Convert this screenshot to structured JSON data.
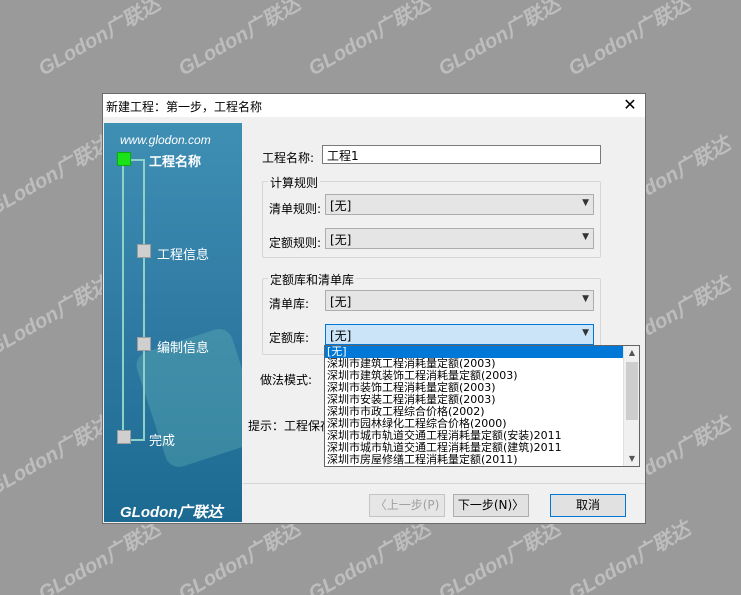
{
  "watermark": "GLodon广联达",
  "dialog": {
    "title": "新建工程：第一步，工程名称",
    "close": "✕"
  },
  "sidebar": {
    "url": "www.glodon.com",
    "logo": "GLodon广联达",
    "steps": [
      {
        "label": "工程名称",
        "active": true
      },
      {
        "label": "工程信息",
        "active": false
      },
      {
        "label": "编制信息",
        "active": false
      },
      {
        "label": "完成",
        "active": false
      }
    ]
  },
  "form": {
    "project_name_label": "工程名称:",
    "project_name_value": "工程1",
    "calc_rules": {
      "legend": "计算规则",
      "list_rule_label": "清单规则:",
      "list_rule_value": "[无]",
      "quota_rule_label": "定额规则:",
      "quota_rule_value": "[无]"
    },
    "libraries": {
      "legend": "定额库和清单库",
      "list_lib_label": "清单库:",
      "list_lib_value": "[无]",
      "quota_lib_label": "定额库:",
      "quota_lib_value": "[无]"
    },
    "method_label": "做法模式:",
    "hint_label": "提示：工程保存"
  },
  "quota_dropdown": {
    "options": [
      "[无]",
      "深圳市建筑工程消耗量定额(2003)",
      "深圳市建筑装饰工程消耗量定额(2003)",
      "深圳市装饰工程消耗量定额(2003)",
      "深圳市安装工程消耗量定额(2003)",
      "深圳市市政工程综合价格(2002)",
      "深圳市园林绿化工程综合价格(2000)",
      "深圳市城市轨道交通工程消耗量定额(安装)2011",
      "深圳市城市轨道交通工程消耗量定额(建筑)2011",
      "深圳市房屋修缮工程消耗量定额(2011)"
    ],
    "selected_index": 0
  },
  "buttons": {
    "prev": "〈上一步(P)",
    "next": "下一步(N)〉",
    "cancel": "取消"
  }
}
